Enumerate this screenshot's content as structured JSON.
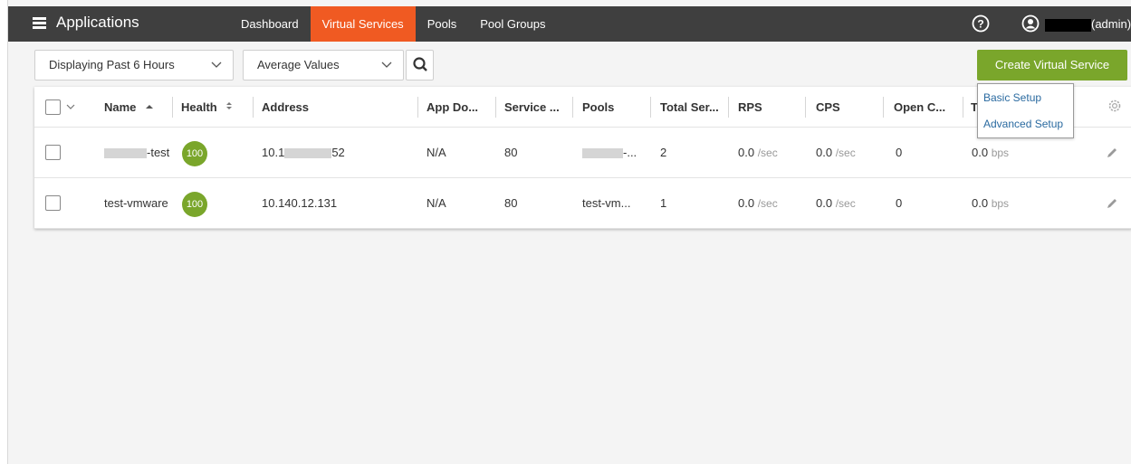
{
  "header": {
    "app_title": "Applications",
    "nav": [
      "Dashboard",
      "Virtual Services",
      "Pools",
      "Pool Groups"
    ],
    "active_nav": "Virtual Services",
    "user_suffix": "(admin)"
  },
  "toolbar": {
    "time_range": "Displaying Past 6 Hours",
    "value_mode": "Average Values",
    "create_label": "Create Virtual Service"
  },
  "create_menu": {
    "items": [
      "Basic Setup",
      "Advanced Setup"
    ]
  },
  "table": {
    "columns": {
      "name": "Name",
      "health": "Health",
      "address": "Address",
      "app_domain": "App Do...",
      "service": "Service ...",
      "pools": "Pools",
      "total_servers": "Total Ser...",
      "rps": "RPS",
      "cps": "CPS",
      "open_conns": "Open C...",
      "throughput": "T"
    },
    "rows": [
      {
        "name_suffix": "-test",
        "health": "100",
        "address_prefix": "10.1",
        "address_suffix": "52",
        "app_domain": "N/A",
        "service": "80",
        "pools_suffix": "-...",
        "total_servers": "2",
        "rps": "0.0",
        "rps_unit": "/sec",
        "cps": "0.0",
        "cps_unit": "/sec",
        "open_conns": "0",
        "throughput": "0.0",
        "throughput_unit": "bps"
      },
      {
        "name": "test-vmware",
        "health": "100",
        "address": "10.140.12.131",
        "app_domain": "N/A",
        "service": "80",
        "pools": "test-vm...",
        "total_servers": "1",
        "rps": "0.0",
        "rps_unit": "/sec",
        "cps": "0.0",
        "cps_unit": "/sec",
        "open_conns": "0",
        "throughput": "0.0",
        "throughput_unit": "bps"
      }
    ]
  },
  "colors": {
    "topbar": "#3f3f3f",
    "active_nav": "#f05a22",
    "create_button": "#7aa62b",
    "health_badge": "#7aa62b",
    "link": "#2a6aa0"
  },
  "icons": [
    "hamburger-icon",
    "help-icon",
    "user-icon",
    "search-icon",
    "sort-asc-icon",
    "sort-icon",
    "gear-icon",
    "edit-icon",
    "chevron-down-icon"
  ]
}
